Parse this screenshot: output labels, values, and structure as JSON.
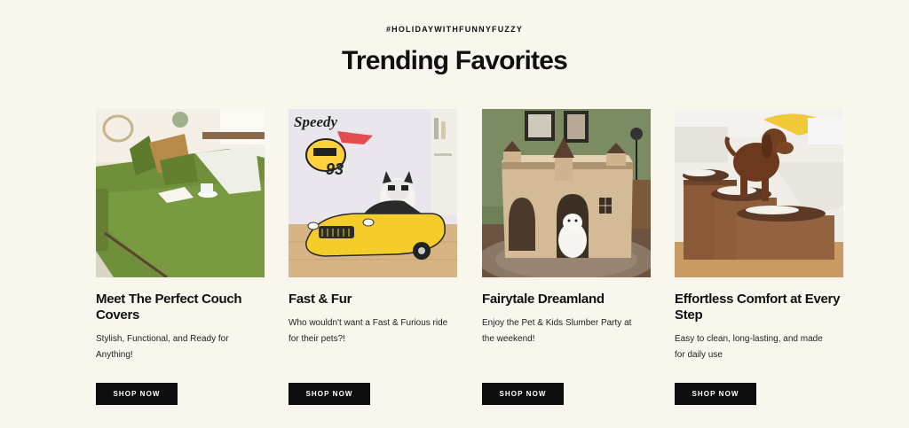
{
  "hashtag": "#HOLIDAYWITHFUNNYFUZZY",
  "section_title": "Trending Favorites",
  "cards": [
    {
      "title": "Meet The Perfect Couch Covers",
      "description": "Stylish, Functional, and Ready for Anything!",
      "button": "SHOP NOW",
      "image": "green-couch-cover-photo"
    },
    {
      "title": "Fast & Fur",
      "description": "Who wouldn't want a Fast & Furious ride for their pets?!",
      "button": "SHOP NOW",
      "image": "race-car-pet-bed-photo",
      "image_text": [
        "Speedy",
        "93"
      ]
    },
    {
      "title": "Fairytale Dreamland",
      "description": "Enjoy the Pet & Kids Slumber Party at the weekend!",
      "button": "SHOP NOW",
      "image": "castle-pet-house-photo"
    },
    {
      "title": "Effortless Comfort at Every Step",
      "description": "Easy to clean, long-lasting, and made for daily use",
      "button": "SHOP NOW",
      "image": "dog-stairs-photo"
    }
  ]
}
